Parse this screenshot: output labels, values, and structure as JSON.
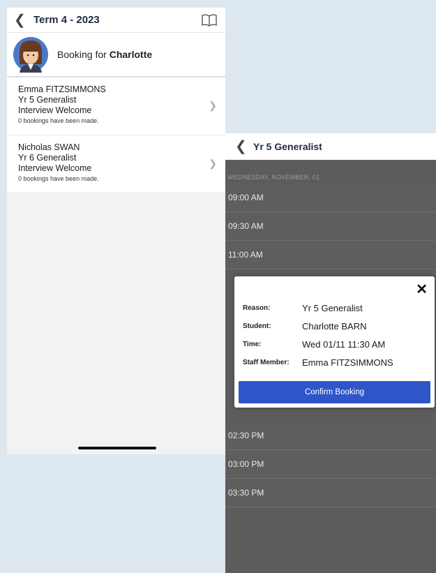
{
  "left": {
    "header": {
      "back_icon": "chevron-left-icon",
      "title": "Term 4 - 2023",
      "book_icon": "book-icon"
    },
    "booking_for": {
      "prefix": "Booking for ",
      "name": "Charlotte"
    },
    "staff": [
      {
        "name": "Emma FITZSIMMONS",
        "subject": "Yr 5 Generalist",
        "type": "Interview Welcome",
        "bookings": "0 bookings have been made."
      },
      {
        "name": "Nicholas SWAN",
        "subject": "Yr 6 Generalist",
        "type": "Interview Welcome",
        "bookings": "0 bookings have been made."
      }
    ]
  },
  "right": {
    "header": {
      "back_icon": "chevron-left-icon",
      "title": "Yr 5 Generalist"
    },
    "date": "WEDNESDAY, NOVEMBER, 01",
    "slots_top": [
      "09:00 AM",
      "09:30 AM",
      "11:00 AM"
    ],
    "slots_bottom": [
      "02:30 PM",
      "03:00 PM",
      "03:30 PM"
    ]
  },
  "modal": {
    "close_icon": "close-icon",
    "rows": [
      {
        "label": "Reason:",
        "value": "Yr 5 Generalist"
      },
      {
        "label": "Student:",
        "value": "Charlotte BARN"
      },
      {
        "label": "Time:",
        "value": "Wed 01/11 11:30 AM"
      },
      {
        "label": "Staff Member:",
        "value": "Emma FITZSIMMONS"
      }
    ],
    "confirm_label": "Confirm Booking"
  },
  "colors": {
    "accent": "#2f56c9",
    "background": "#dde7f0",
    "overlay": "#5c5c5c"
  }
}
